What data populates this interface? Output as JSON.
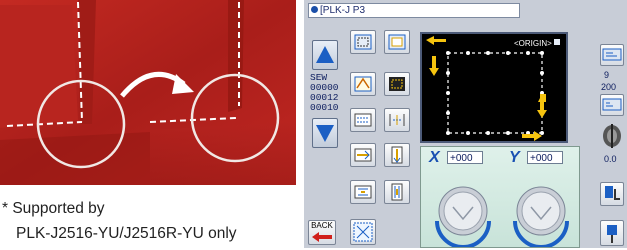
{
  "note": {
    "line1": "* Supported by",
    "line2": "PLK-J2516-YU/J2516R-YU only"
  },
  "panel": {
    "title": "[PLK-J P3",
    "screen_label": "<ORIGIN>",
    "counter": {
      "label": "SEW",
      "values": [
        "00000",
        "00012",
        "00010"
      ]
    },
    "right_values": [
      "9",
      "200",
      "0.0"
    ],
    "x_axis_label": "X",
    "y_axis_label": "Y",
    "x_value": "+000",
    "y_value": "+000",
    "back_label": "BACK"
  },
  "colors": {
    "fabric": "#b5231e",
    "panel_bg": "#c8cdd7",
    "screen_bg": "#000000",
    "accent_blue": "#1b5fc4",
    "highlight_yellow": "#f6c40f",
    "knob_panel": "#d3eae2"
  },
  "icons": [
    "curved-arrow-icon",
    "scroll-up-icon",
    "scroll-down-icon",
    "back-icon",
    "stitch-pattern-icon",
    "high-speed-icon",
    "low-speed-icon",
    "thread-spool-icon",
    "presser-foot-icon",
    "needle-icon",
    "knob-icon"
  ]
}
